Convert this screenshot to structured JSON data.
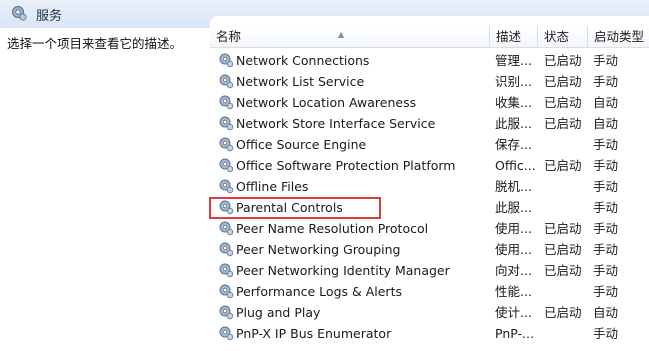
{
  "header": {
    "title": "服务"
  },
  "left_pane": {
    "description_hint": "选择一个项目来查看它的描述。"
  },
  "columns": {
    "name": "名称",
    "description": "描述",
    "status": "状态",
    "startup": "启动类型"
  },
  "icon_name": "gear-service-icon",
  "highlight_color": "#e23b3b",
  "rows": [
    {
      "name": "Network Connections",
      "desc": "管理...",
      "status": "已启动",
      "startup": "手动"
    },
    {
      "name": "Network List Service",
      "desc": "识别...",
      "status": "已启动",
      "startup": "手动"
    },
    {
      "name": "Network Location Awareness",
      "desc": "收集...",
      "status": "已启动",
      "startup": "自动"
    },
    {
      "name": "Network Store Interface Service",
      "desc": "此服...",
      "status": "已启动",
      "startup": "自动"
    },
    {
      "name": "Office  Source Engine",
      "desc": "保存...",
      "status": "",
      "startup": "手动"
    },
    {
      "name": "Office Software Protection Platform",
      "desc": "Offic...",
      "status": "已启动",
      "startup": "手动"
    },
    {
      "name": "Offline Files",
      "desc": "脱机...",
      "status": "",
      "startup": "手动"
    },
    {
      "name": "Parental Controls",
      "desc": "此服...",
      "status": "",
      "startup": "手动"
    },
    {
      "name": "Peer Name Resolution Protocol",
      "desc": "使用...",
      "status": "已启动",
      "startup": "手动"
    },
    {
      "name": "Peer Networking Grouping",
      "desc": "使用...",
      "status": "已启动",
      "startup": "手动"
    },
    {
      "name": "Peer Networking Identity Manager",
      "desc": "向对...",
      "status": "已启动",
      "startup": "手动"
    },
    {
      "name": "Performance Logs & Alerts",
      "desc": "性能...",
      "status": "",
      "startup": "手动"
    },
    {
      "name": "Plug and Play",
      "desc": "使计...",
      "status": "已启动",
      "startup": "自动"
    },
    {
      "name": "PnP-X IP Bus Enumerator",
      "desc": "PnP-...",
      "status": "",
      "startup": "手动"
    }
  ]
}
